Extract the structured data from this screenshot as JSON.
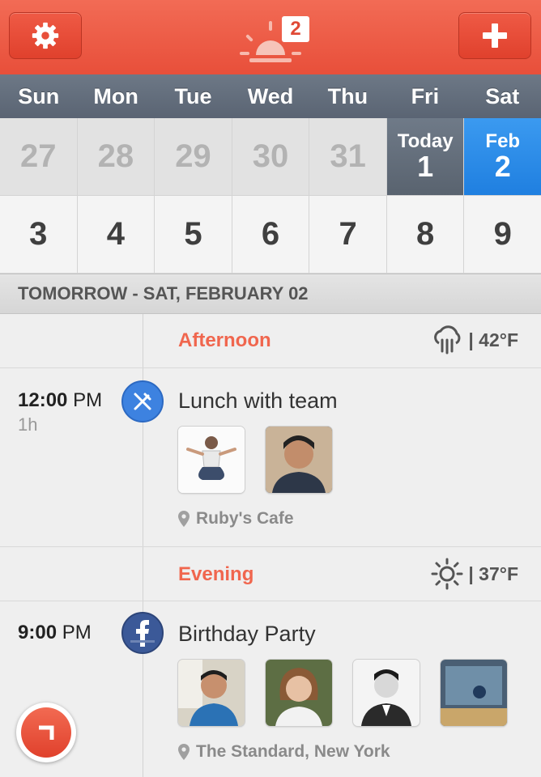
{
  "header": {
    "settings_icon": "gear-icon",
    "add_icon": "plus-icon",
    "logo_icon": "sunrise-icon",
    "badge_count": "2",
    "accent_color": "#e84f3a"
  },
  "days": [
    "Sun",
    "Mon",
    "Tue",
    "Wed",
    "Thu",
    "Fri",
    "Sat"
  ],
  "week1": [
    {
      "num": "27"
    },
    {
      "num": "28"
    },
    {
      "num": "29"
    },
    {
      "num": "30"
    },
    {
      "num": "31"
    },
    {
      "label": "Today",
      "num": "1"
    },
    {
      "label": "Feb",
      "num": "2"
    }
  ],
  "week2": [
    "3",
    "4",
    "5",
    "6",
    "7",
    "8",
    "9"
  ],
  "date_header": "TOMORROW - SAT, FEBRUARY 02",
  "afternoon": {
    "label": "Afternoon",
    "weather_icon": "rain-cloud-icon",
    "temp": "| 42°F"
  },
  "event1": {
    "time": "12:00",
    "ampm": "PM",
    "duration": "1h",
    "icon": "fork-knife-icon",
    "icon_color": "#3d82e0",
    "title": "Lunch with team",
    "location": "Ruby's Cafe"
  },
  "evening": {
    "label": "Evening",
    "weather_icon": "sun-icon",
    "temp": "| 37°F"
  },
  "event2": {
    "time": "9:00",
    "ampm": "PM",
    "icon": "facebook-icon",
    "icon_color": "#3b5998",
    "title": "Birthday Party",
    "location": "The Standard, New York"
  }
}
